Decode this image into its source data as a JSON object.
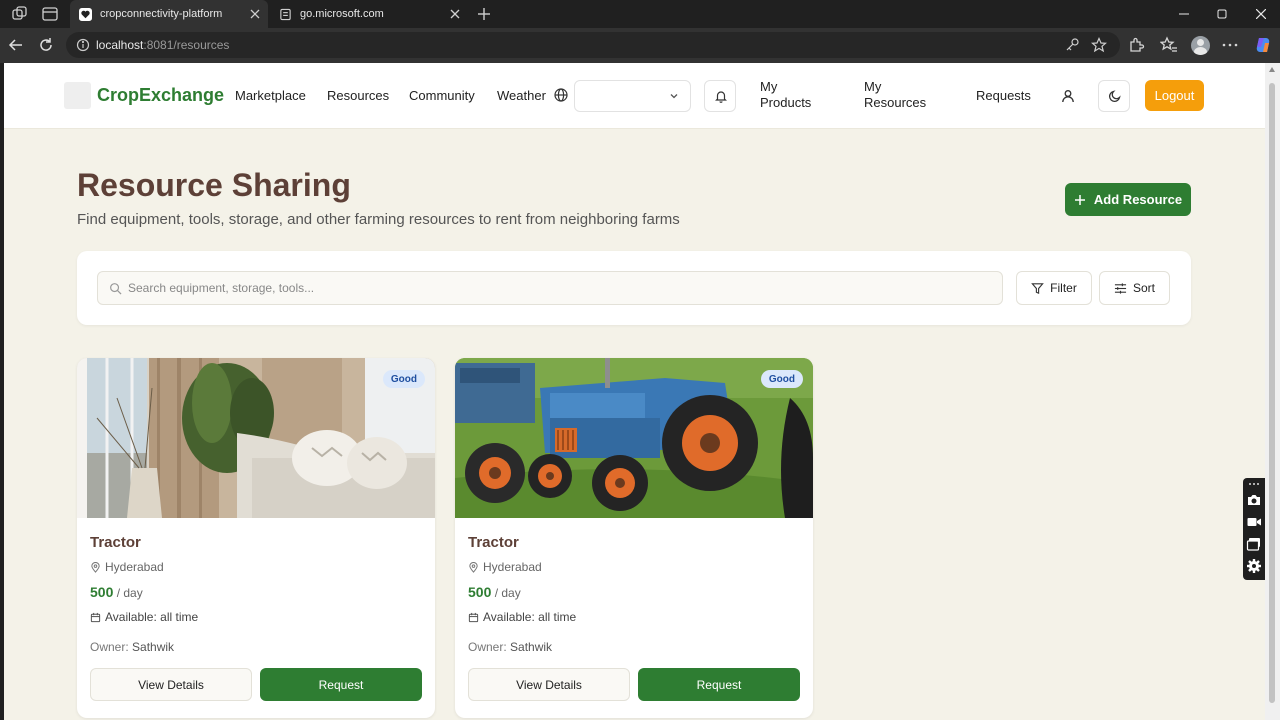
{
  "browser": {
    "tabs": [
      {
        "title": "cropconnectivity-platform",
        "active": true
      },
      {
        "title": "go.microsoft.com",
        "active": false
      }
    ],
    "url": {
      "host": "localhost",
      "rest": ":8081/resources"
    }
  },
  "nav": {
    "brand": "CropExchange",
    "links": [
      "Marketplace",
      "Resources",
      "Community",
      "Weather"
    ],
    "language_value": "",
    "my_products": "My Products",
    "my_resources": "My Resources",
    "requests": "Requests",
    "logout": "Logout"
  },
  "hero": {
    "title": "Resource Sharing",
    "subtitle": "Find equipment, tools, storage, and other farming resources to rent from neighboring farms",
    "add_button": "Add Resource"
  },
  "search": {
    "placeholder": "Search equipment, storage, tools...",
    "filter": "Filter",
    "sort": "Sort"
  },
  "resources": [
    {
      "badge": "Good",
      "title": "Tractor",
      "location": "Hyderabad",
      "price": "500",
      "unit": "/ day",
      "availability": "Available: all time",
      "owner_label": "Owner:",
      "owner": "Sathwik",
      "details_label": "View Details",
      "request_label": "Request",
      "image": "living-room-photo"
    },
    {
      "badge": "Good",
      "title": "Tractor",
      "location": "Hyderabad",
      "price": "500",
      "unit": "/ day",
      "availability": "Available: all time",
      "owner_label": "Owner:",
      "owner": "Sathwik",
      "details_label": "View Details",
      "request_label": "Request",
      "image": "blue-tractor-photo"
    }
  ],
  "colors": {
    "brand_green": "#2e7d32",
    "title_brown": "#5d4037",
    "logout_orange": "#f59e0b",
    "page_bg": "#f4f2e8",
    "badge_bg": "#dbe8fb"
  }
}
